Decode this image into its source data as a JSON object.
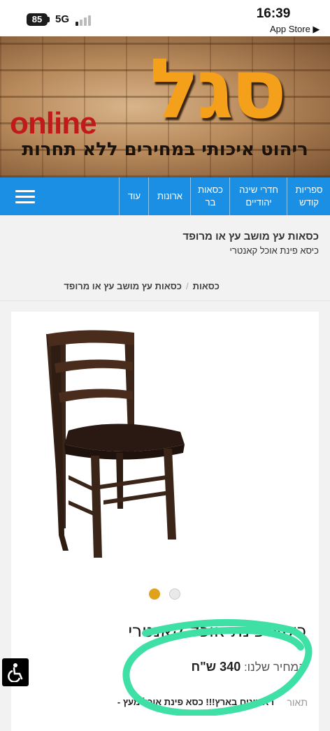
{
  "status_bar": {
    "battery": "85",
    "network": "5G",
    "time": "16:39",
    "back_link": "App Store ▶"
  },
  "banner": {
    "logo_hebrew": "סגל",
    "logo_latin": "online",
    "slogan": "ריהוט איכותי במחירים ללא תחרות",
    "colors": {
      "logo": "#f5a01a",
      "online": "#c11a1a"
    }
  },
  "nav": {
    "items": [
      {
        "label": "ספריות קודש"
      },
      {
        "label": "חדרי שינה יהודיים"
      },
      {
        "label": "כסאות בר"
      },
      {
        "label": "ארונות"
      },
      {
        "label": "עוד"
      }
    ],
    "menu_icon": "hamburger-icon",
    "color": "#1a8fe3"
  },
  "page_header": {
    "title": "כסאות עץ מושב עץ או מרופד",
    "subtitle": "כיסא פינת אוכל קאנטרי"
  },
  "breadcrumb": {
    "items": [
      "כסאות",
      "כסאות עץ מושב עץ או מרופד"
    ],
    "separator": "/"
  },
  "product": {
    "title": "כיסא פינת אוכל קאנטרי",
    "price_label": "המחיר שלנו:",
    "price": "340 ש\"ח",
    "description_label": "תאור",
    "description_text": "ראשונים בארץ!!! כסא פינת אוכל מעץ -",
    "gallery": {
      "slides": 2,
      "active": 1,
      "active_color": "#e0a21c"
    },
    "annotation_color": "#3ee0a6"
  },
  "accessibility_button": {
    "icon": "wheelchair-icon"
  }
}
